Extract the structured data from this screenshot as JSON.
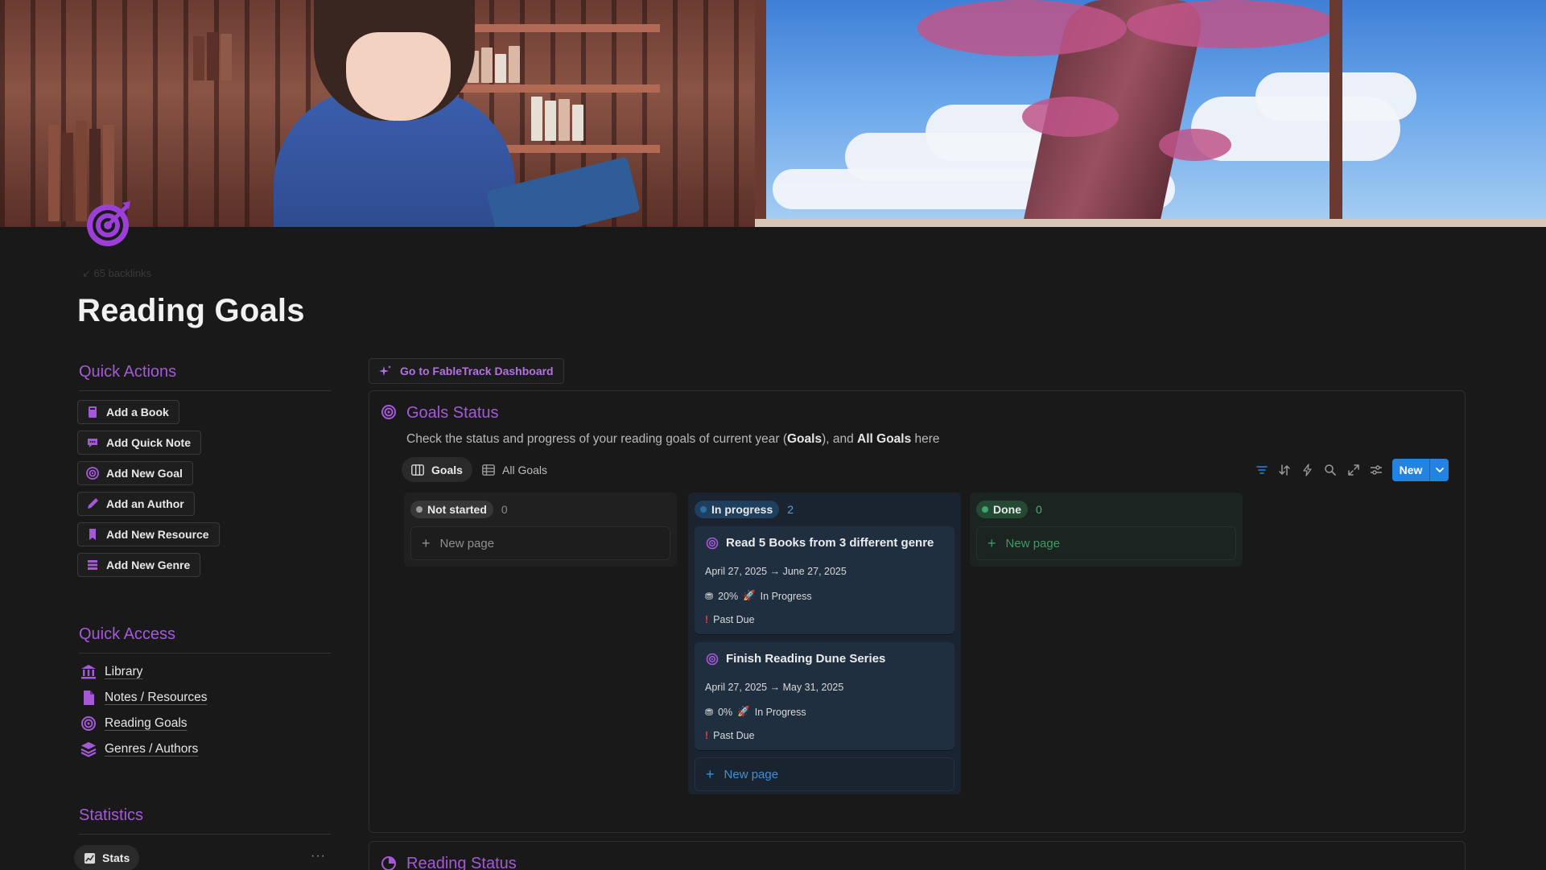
{
  "page": {
    "title": "Reading Goals",
    "backlinks": "65 backlinks"
  },
  "quick_actions": {
    "heading": "Quick Actions",
    "buttons": [
      {
        "label": "Add a Book",
        "icon": "book-icon"
      },
      {
        "label": "Add Quick Note",
        "icon": "chat-bubble-icon"
      },
      {
        "label": "Add New Goal",
        "icon": "target-icon"
      },
      {
        "label": "Add an Author",
        "icon": "pen-icon"
      },
      {
        "label": "Add New Resource",
        "icon": "bookmark-icon"
      },
      {
        "label": "Add New Genre",
        "icon": "stack-icon"
      }
    ]
  },
  "quick_access": {
    "heading": "Quick Access",
    "links": [
      {
        "label": "Library",
        "icon": "building-columns-icon"
      },
      {
        "label": "Notes / Resources",
        "icon": "document-icon"
      },
      {
        "label": "Reading Goals",
        "icon": "target-icon"
      },
      {
        "label": "Genres / Authors",
        "icon": "layers-icon"
      }
    ]
  },
  "statistics": {
    "heading": "Statistics",
    "tab_label": "Stats",
    "more": "···"
  },
  "dashboard_link": "Go to FableTrack Dashboard",
  "goals_status": {
    "title": "Goals Status",
    "desc_pre": "Check the status and progress of your reading goals of current year (",
    "desc_bold1": "Goals",
    "desc_mid": "), and ",
    "desc_bold2": "All Goals",
    "desc_post": " here",
    "views": [
      "Goals",
      "All Goals"
    ],
    "new_button": "New",
    "columns": [
      {
        "status": "Not started",
        "count": "0",
        "new_page": "New page",
        "dot": "#9b9b9b",
        "pill_bg": "#373737",
        "text": "#9b9b9b"
      },
      {
        "status": "In progress",
        "count": "2",
        "new_page": "New page",
        "dot": "#2b6ea6",
        "pill_bg": "#1f3f5e",
        "text": "#5a9fd6"
      },
      {
        "status": "Done",
        "count": "0",
        "new_page": "New page",
        "dot": "#3fa36b",
        "pill_bg": "#244a34",
        "text": "#4fae78"
      }
    ],
    "cards": [
      {
        "title": "Read 5 Books from 3 different genre",
        "dates": "April 27, 2025 → June 27, 2025",
        "progress": "20%",
        "progress_value": 0.2,
        "status": "In Progress",
        "due": "Past Due"
      },
      {
        "title": "Finish Reading Dune Series",
        "dates": "April 27, 2025 → May 31, 2025",
        "progress": "0%",
        "progress_value": 0.0,
        "status": "In Progress",
        "due": "Past Due"
      }
    ]
  },
  "reading_status": {
    "title": "Reading Status"
  },
  "colors": {
    "accent_purple": "#a45ad8",
    "new_button_blue": "#2383e2",
    "background": "#191919"
  }
}
